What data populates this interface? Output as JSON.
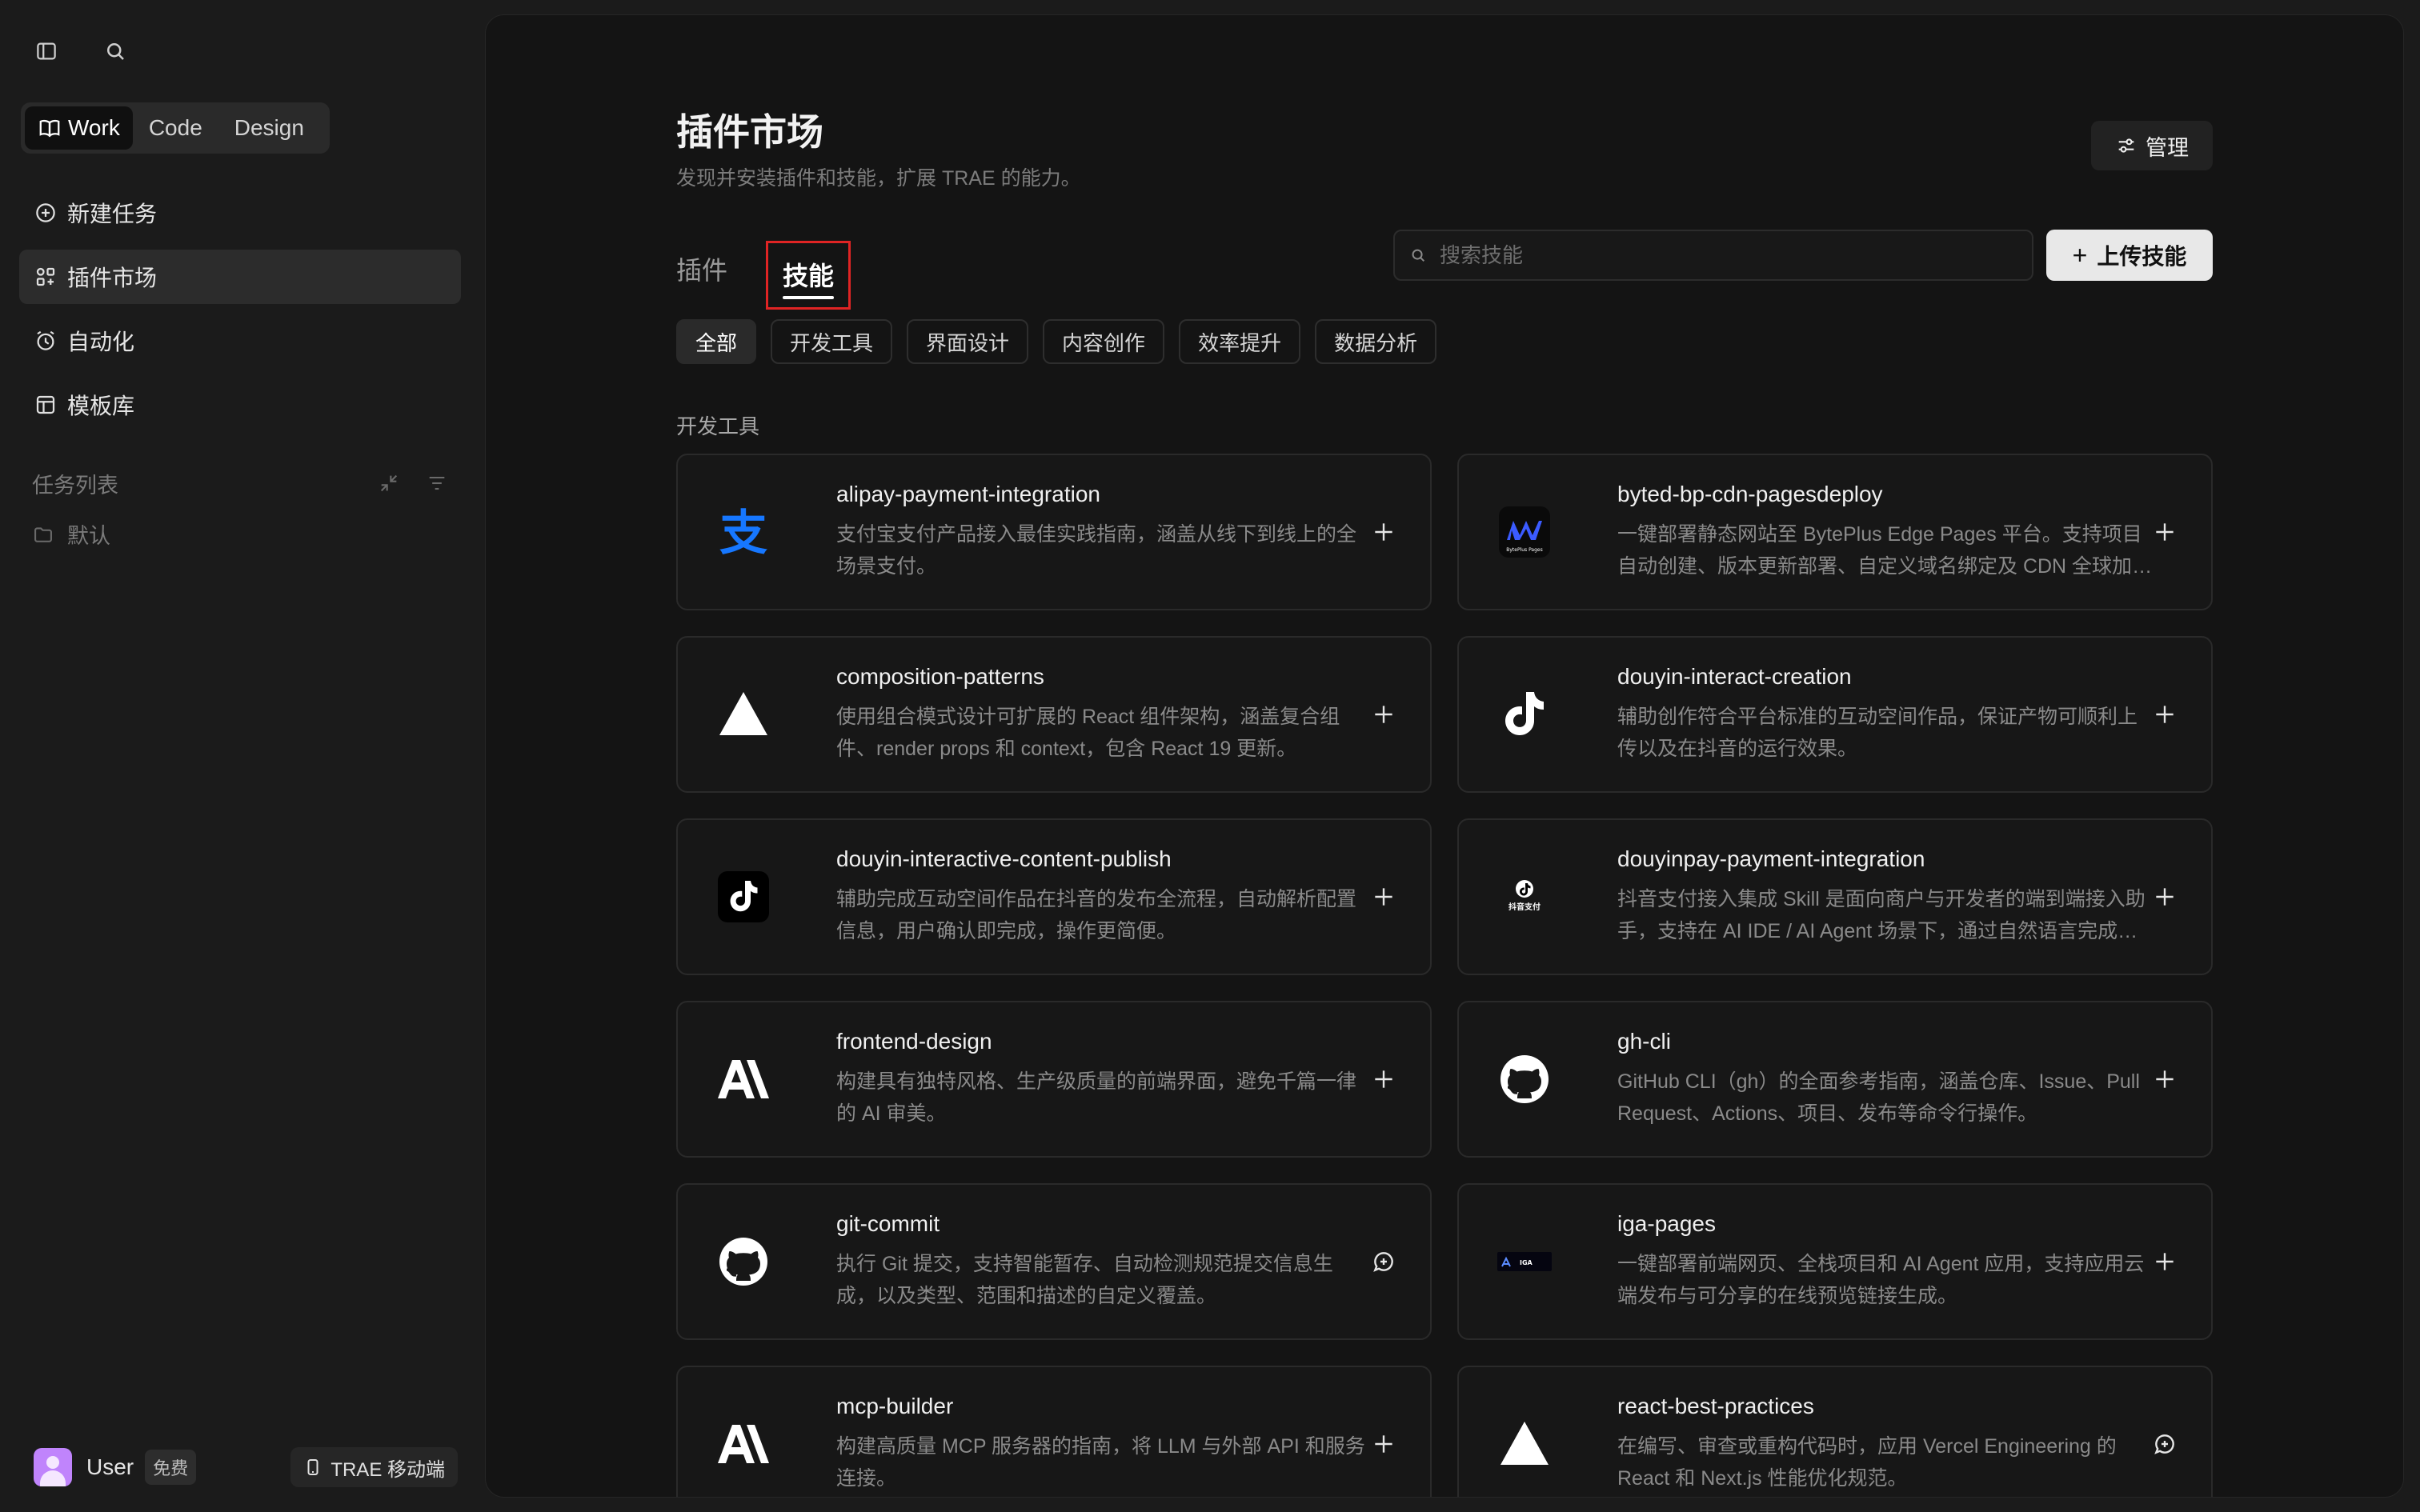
{
  "sidebar": {
    "modes": [
      {
        "label": "Work",
        "active": true
      },
      {
        "label": "Code",
        "active": false
      },
      {
        "label": "Design",
        "active": false
      }
    ],
    "nav": [
      {
        "label": "新建任务",
        "icon": "plus-circle-icon",
        "active": false
      },
      {
        "label": "插件市场",
        "icon": "grid-icon",
        "active": true
      },
      {
        "label": "自动化",
        "icon": "clock-icon",
        "active": false
      },
      {
        "label": "模板库",
        "icon": "template-icon",
        "active": false
      }
    ],
    "task_list_title": "任务列表",
    "folder_default": "默认",
    "user_name": "User",
    "plan": "免费",
    "mobile_label": "TRAE 移动端"
  },
  "main": {
    "title": "插件市场",
    "subtitle": "发现并安装插件和技能，扩展 TRAE 的能力。",
    "manage_label": "管理",
    "tabs": [
      {
        "label": "插件",
        "active": false
      },
      {
        "label": "技能",
        "active": true
      }
    ],
    "search_placeholder": "搜索技能",
    "upload_label": "上传技能",
    "chips": [
      {
        "label": "全部",
        "active": true
      },
      {
        "label": "开发工具",
        "active": false
      },
      {
        "label": "界面设计",
        "active": false
      },
      {
        "label": "内容创作",
        "active": false
      },
      {
        "label": "效率提升",
        "active": false
      },
      {
        "label": "数据分析",
        "active": false
      }
    ],
    "section_label": "开发工具",
    "cards": [
      {
        "title": "alipay-payment-integration",
        "desc": "支付宝支付产品接入最佳实践指南，涵盖从线下到线上的全场景支付。",
        "logo": "alipay-logo-icon",
        "action": "plus-icon"
      },
      {
        "title": "byted-bp-cdn-pagesdeploy",
        "desc": "一键部署静态网站至 BytePlus Edge Pages 平台。支持项目自动创建、版本更新部署、自定义域名绑定及 CDN 全球加速等功能。",
        "logo": "byteplus-pages-logo-icon",
        "action": "plus-icon",
        "logo_text": "BytePlus Pages"
      },
      {
        "title": "composition-patterns",
        "desc": "使用组合模式设计可扩展的 React 组件架构，涵盖复合组件、render props 和 context，包含 React 19 更新。",
        "logo": "vercel-triangle-icon",
        "action": "plus-icon"
      },
      {
        "title": "douyin-interact-creation",
        "desc": "辅助创作符合平台标准的互动空间作品，保证产物可顺利上传以及在抖音的运行效果。",
        "logo": "tiktok-icon",
        "action": "plus-icon"
      },
      {
        "title": "douyin-interactive-content-publish",
        "desc": "辅助完成互动空间作品在抖音的发布全流程，自动解析配置信息，用户确认即完成，操作更简便。",
        "logo": "tiktok-boxed-icon",
        "action": "plus-icon"
      },
      {
        "title": "douyinpay-payment-integration",
        "desc": "抖音支付接入集成 Skill 是面向商户与开发者的端到端接入助手，支持在 AI IDE / AI Agent 场景下，通过自然语言完成支付接入。",
        "logo": "douyinpay-logo-icon",
        "action": "plus-icon",
        "logo_text": "抖音支付"
      },
      {
        "title": "frontend-design",
        "desc": "构建具有独特风格、生产级质量的前端界面，避免千篇一律的 AI 审美。",
        "logo": "anthropic-logo-icon",
        "action": "plus-icon"
      },
      {
        "title": "gh-cli",
        "desc": "GitHub CLI（gh）的全面参考指南，涵盖仓库、Issue、Pull Request、Actions、项目、发布等命令行操作。",
        "logo": "github-logo-icon",
        "action": "plus-icon"
      },
      {
        "title": "git-commit",
        "desc": "执行 Git 提交，支持智能暂存、自动检测规范提交信息生成，以及类型、范围和描述的自定义覆盖。",
        "logo": "github-logo-icon",
        "action": "chat-plus-icon"
      },
      {
        "title": "iga-pages",
        "desc": "一键部署前端网页、全栈项目和 AI Agent 应用，支持应用云端发布与可分享的在线预览链接生成。",
        "logo": "iga-logo-icon",
        "action": "plus-icon",
        "logo_text": "IGA"
      },
      {
        "title": "mcp-builder",
        "desc": "构建高质量 MCP 服务器的指南，将 LLM 与外部 API 和服务连接。",
        "logo": "anthropic-logo-icon",
        "action": "plus-icon"
      },
      {
        "title": "react-best-practices",
        "desc": "在编写、审查或重构代码时，应用 Vercel Engineering 的 React 和 Next.js 性能优化规范。",
        "logo": "vercel-triangle-icon",
        "action": "chat-plus-icon"
      }
    ]
  },
  "colors": {
    "accent": "#e8e8e8",
    "highlight_box": "#e02424",
    "alipay_blue": "#1677ff",
    "byteplus_blue": "#3b5bff"
  }
}
